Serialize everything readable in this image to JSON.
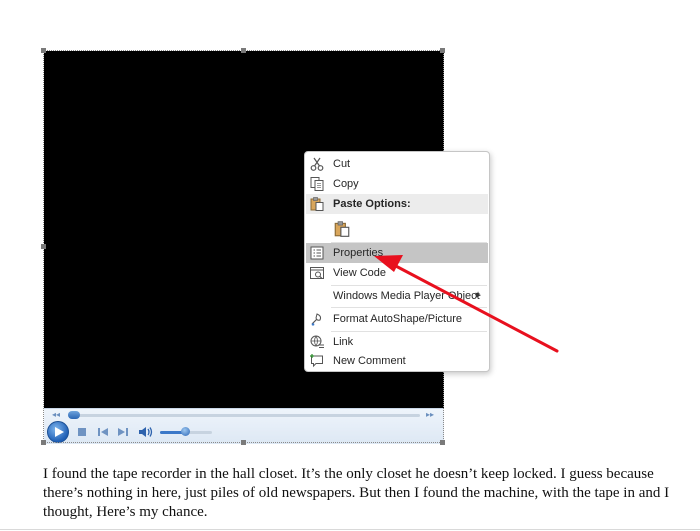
{
  "media_player": {
    "playing": false,
    "seek_position": 0.02,
    "volume_level": 0.55
  },
  "context_menu": {
    "items": [
      {
        "label": "Cut",
        "icon": "scissors-icon"
      },
      {
        "label": "Copy",
        "icon": "copy-icon"
      },
      {
        "label": "Paste Options:",
        "icon": "clipboard-icon"
      },
      {
        "label": "",
        "icon": "paste-keep-formatting-icon"
      },
      {
        "label": "Properties",
        "icon": "properties-icon"
      },
      {
        "label": "View Code",
        "icon": "view-code-icon"
      },
      {
        "label": "Windows Media Player Object",
        "icon": ""
      },
      {
        "label": "Format AutoShape/Picture",
        "icon": "format-shape-icon"
      },
      {
        "label": "Link",
        "icon": "link-icon"
      },
      {
        "label": "New Comment",
        "icon": "new-comment-icon"
      }
    ],
    "highlighted_item": "Properties"
  },
  "annotation": {
    "color": "#e8101e"
  },
  "document": {
    "paragraph": "I found the tape recorder in the hall closet. It’s the only closet he doesn’t keep locked. I guess because there’s nothing in here, just piles of old newspapers. But then I found the machine, with the tape in and I thought, Here’s my chance."
  }
}
